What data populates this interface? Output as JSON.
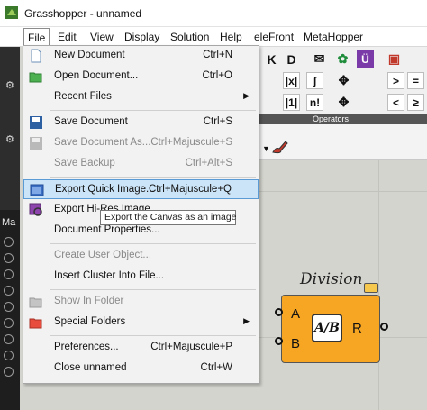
{
  "window": {
    "title": "Grasshopper - unnamed"
  },
  "menubar": {
    "items": [
      "File",
      "Edit",
      "View",
      "Display",
      "Solution",
      "Help",
      "eleFront",
      "MetaHopper"
    ]
  },
  "file_menu": {
    "items": [
      {
        "label": "New Document",
        "shortcut": "Ctrl+N",
        "icon": "new-document-icon"
      },
      {
        "label": "Open Document...",
        "shortcut": "Ctrl+O",
        "icon": "open-folder-icon"
      },
      {
        "label": "Recent Files",
        "shortcut": "",
        "submenu": true
      },
      {
        "label": "Save Document",
        "shortcut": "Ctrl+S",
        "icon": "save-icon"
      },
      {
        "label": "Save Document As...",
        "shortcut": "Ctrl+Majuscule+S",
        "disabled": true,
        "icon": "save-as-icon"
      },
      {
        "label": "Save Backup",
        "shortcut": "Ctrl+Alt+S",
        "disabled": true
      },
      {
        "label": "Export Quick Image...",
        "shortcut": "Ctrl+Majuscule+Q",
        "highlighted": true,
        "icon": "export-image-icon"
      },
      {
        "label": "Export Hi-Res Image...",
        "shortcut": "",
        "icon": "export-hires-icon"
      },
      {
        "label": "Document Properties...",
        "shortcut": ""
      },
      {
        "label": "Create User Object...",
        "shortcut": "",
        "disabled": true
      },
      {
        "label": "Insert Cluster Into File...",
        "shortcut": ""
      },
      {
        "label": "Show In Folder",
        "shortcut": "",
        "disabled": true,
        "icon": "folder-icon"
      },
      {
        "label": "Special Folders",
        "shortcut": "",
        "submenu": true,
        "icon": "special-folder-icon"
      },
      {
        "label": "Preferences...",
        "shortcut": "Ctrl+Majuscule+P"
      },
      {
        "label": "Close unnamed",
        "shortcut": "Ctrl+W"
      }
    ],
    "tooltip": "Export the Canvas as an image"
  },
  "toolbar": {
    "operators_label": "Operators",
    "row1": [
      "K",
      "D",
      "✉",
      "✿",
      "Ü",
      "▣"
    ],
    "row2": [
      "|x|",
      "ʃ",
      "%",
      "✥",
      ">",
      "="
    ],
    "row3": [
      "|1|",
      "n!",
      "%",
      "✥",
      "<",
      "≥"
    ]
  },
  "left_panel": {
    "label": "Ma"
  },
  "component": {
    "name": "Division",
    "inputs": [
      "A",
      "B"
    ],
    "outputs": [
      "R"
    ],
    "icon_text": "A/B",
    "color": "#f6a623"
  }
}
